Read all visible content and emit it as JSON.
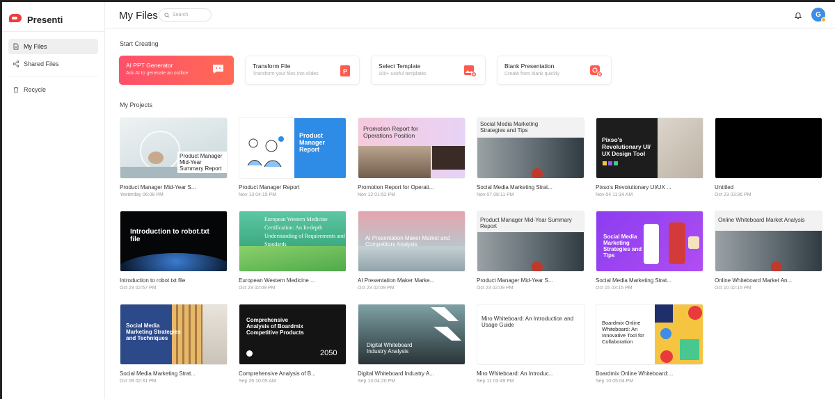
{
  "app": {
    "name": "Presenti"
  },
  "sidebar": {
    "items": [
      {
        "label": "My Files",
        "icon": "file-icon",
        "active": true
      },
      {
        "label": "Shared Files",
        "icon": "share-icon",
        "active": false
      },
      {
        "label": "Recycle",
        "icon": "trash-icon",
        "active": false
      }
    ]
  },
  "header": {
    "title": "My Files",
    "search_placeholder": "Search",
    "avatar_initial": "G"
  },
  "start_creating": {
    "title": "Start Creating",
    "cards": [
      {
        "title": "AI PPT Generator",
        "subtitle": "Ask AI to generate an outline",
        "icon": "chat-icon",
        "accent": "#ff5161"
      },
      {
        "title": "Transform File",
        "subtitle": "Transform your files into slides",
        "icon": "ppt-icon",
        "accent": "#ff5a4e"
      },
      {
        "title": "Select Template",
        "subtitle": "100+ useful templates",
        "icon": "image-add-icon",
        "accent": "#ff5a4e"
      },
      {
        "title": "Blank Presentation",
        "subtitle": "Create from blank quickly",
        "icon": "blank-slide-icon",
        "accent": "#ff5a4e"
      }
    ]
  },
  "projects": {
    "title": "My Projects",
    "items": [
      {
        "name": "Product Manager Mid-Year S...",
        "date": "Yesterday 06:08 PM",
        "thumb_text": "Product Manager Mid-Year Summary Report"
      },
      {
        "name": "Product Manager Report",
        "date": "Nov 13 04:15 PM",
        "thumb_text": "Product Manager Report"
      },
      {
        "name": "Promotion Report for Operati...",
        "date": "Nov 12 01:52 PM",
        "thumb_text": "Promotion Report for Operations Position"
      },
      {
        "name": "Social Media Marketing Strat...",
        "date": "Nov 07 08:11 PM",
        "thumb_text": "Social Media Marketing Strategies and Tips"
      },
      {
        "name": "Pixso's Revolutionary UI/UX ...",
        "date": "Nov 04 11:34 AM",
        "thumb_text": "Pixso's Revolutionary UI/ UX Design Tool"
      },
      {
        "name": "Untitled",
        "date": "Oct 23 03:36 PM",
        "thumb_text": ""
      },
      {
        "name": "Introduction to robot.txt file",
        "date": "Oct 23 02:57 PM",
        "thumb_text": "Introduction to robot.txt file"
      },
      {
        "name": "European Western Medicine ...",
        "date": "Oct 23 02:09 PM",
        "thumb_text": "European Western Medicine Certification: An In-depth Understanding of Requirements and Standards"
      },
      {
        "name": "AI Presentation Maker Marke...",
        "date": "Oct 23 02:09 PM",
        "thumb_text": "AI Presentation Maker Market and Competitors Analysis"
      },
      {
        "name": "Product Manager Mid-Year S...",
        "date": "Oct 23 02:09 PM",
        "thumb_text": "Product Manager Mid-Year Summary Report"
      },
      {
        "name": "Social Media Marketing Strat...",
        "date": "Oct 15 03:15 PM",
        "thumb_text": "Social Media Marketing Strategies and Tips"
      },
      {
        "name": "Online Whiteboard Market An...",
        "date": "Oct 10 02:15 PM",
        "thumb_text": "Online Whiteboard Market Analysis"
      },
      {
        "name": "Social Media Marketing Strat...",
        "date": "Oct 09 02:31 PM",
        "thumb_text": "Social Media Marketing Strategies and Techniques"
      },
      {
        "name": "Comprehensive Analysis of B...",
        "date": "Sep 26 10:05 AM",
        "thumb_text": "Comprehensive Analysis of Boardmix Competitive Products",
        "thumb_year": "2050"
      },
      {
        "name": "Digital Whiteboard Industry A...",
        "date": "Sep 13 04:20 PM",
        "thumb_text": "Digital Whiteboard Industry Analysis"
      },
      {
        "name": "Miro Whiteboard: An Introduc...",
        "date": "Sep 11 03:49 PM",
        "thumb_text": "Miro Whiteboard: An Introduction and Usage Guide"
      },
      {
        "name": "Boardmix Online Whiteboard:...",
        "date": "Sep 10 05:04 PM",
        "thumb_text": "Boardmix Online Whiteboard: An Innovative Tool for Collaboration"
      }
    ]
  }
}
